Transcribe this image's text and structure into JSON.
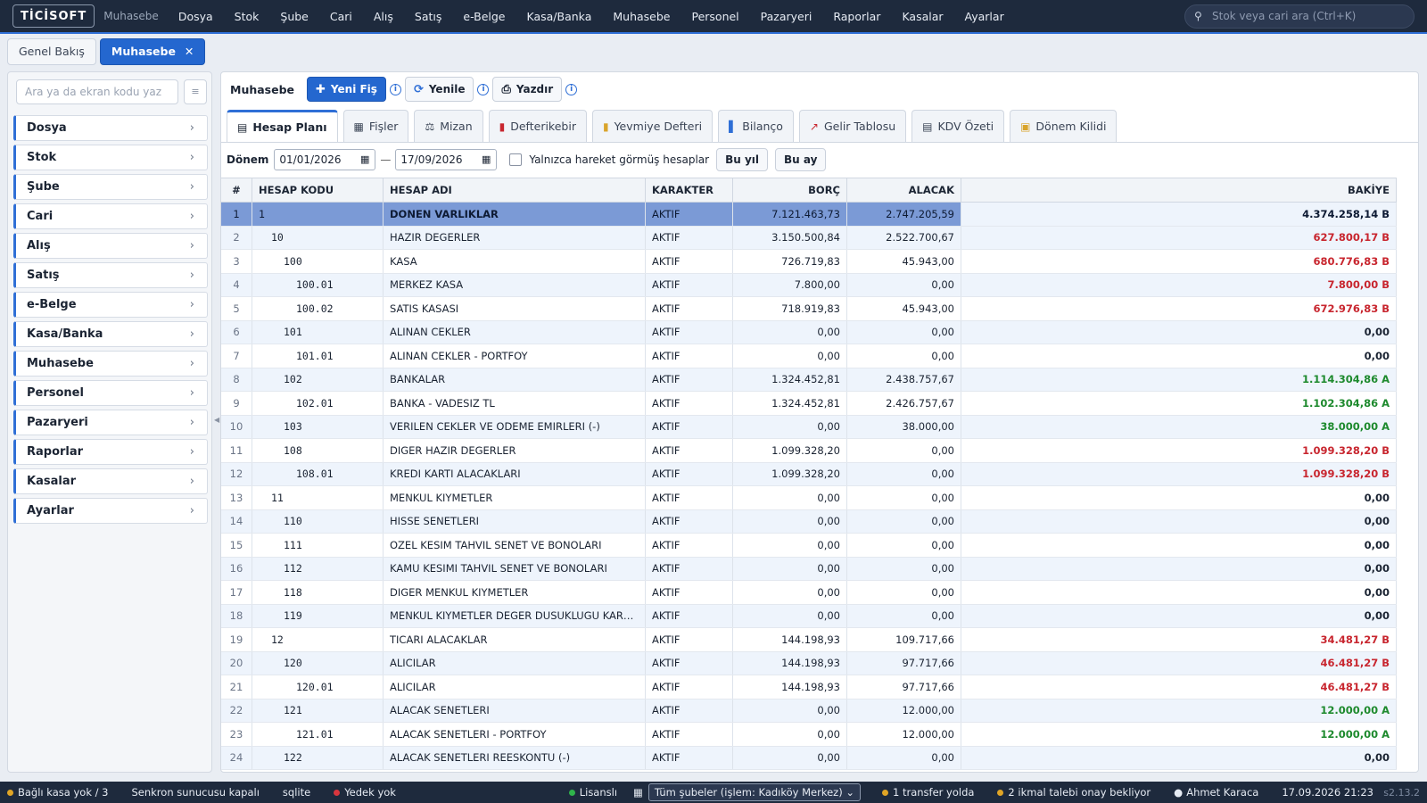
{
  "app": {
    "logo": "TİCİSOFT",
    "module": "Muhasebe"
  },
  "menu": [
    "Dosya",
    "Stok",
    "Şube",
    "Cari",
    "Alış",
    "Satış",
    "e-Belge",
    "Kasa/Banka",
    "Muhasebe",
    "Personel",
    "Pazaryeri",
    "Raporlar",
    "Kasalar",
    "Ayarlar"
  ],
  "search": {
    "placeholder": "Stok veya cari ara (Ctrl+K)"
  },
  "page_tabs": [
    {
      "label": "Genel Bakış"
    },
    {
      "label": "Muhasebe",
      "close": "✕"
    }
  ],
  "sidebar": {
    "search_placeholder": "Ara ya da ekran kodu yaz",
    "items": [
      "Dosya",
      "Stok",
      "Şube",
      "Cari",
      "Alış",
      "Satış",
      "e-Belge",
      "Kasa/Banka",
      "Muhasebe",
      "Personel",
      "Pazaryeri",
      "Raporlar",
      "Kasalar",
      "Ayarlar"
    ]
  },
  "toolbar": {
    "title": "Muhasebe",
    "new_label": "Yeni Fiş",
    "refresh_label": "Yenile",
    "print_label": "Yazdır",
    "info": "i"
  },
  "subtabs": [
    "Hesap Planı",
    "Fişler",
    "Mizan",
    "Defterikebir",
    "Yevmiye Defteri",
    "Bilanço",
    "Gelir Tablosu",
    "KDV Özeti",
    "Dönem Kilidi"
  ],
  "filter": {
    "label": "Dönem",
    "from": "01/01/2026",
    "to": "17/09/2026",
    "sep": "—",
    "only_moved": "Yalnızca hareket görmüş hesaplar",
    "this_year": "Bu yıl",
    "this_month": "Bu ay"
  },
  "table": {
    "headers": {
      "idx": "#",
      "code": "HESAP KODU",
      "name": "HESAP ADI",
      "type": "KARAKTER",
      "debit": "BORÇ",
      "credit": "ALACAK",
      "balance": "BAKİYE"
    },
    "rows": [
      {
        "i": "1",
        "code": "1",
        "lvl": 0,
        "name": "DONEN VARLIKLAR",
        "type": "AKTIF",
        "debit": "7.121.463,73",
        "credit": "2.747.205,59",
        "bal": "4.374.258,14 B",
        "s": "neg"
      },
      {
        "i": "2",
        "code": "10",
        "lvl": 1,
        "name": "HAZIR DEGERLER",
        "type": "AKTIF",
        "debit": "3.150.500,84",
        "credit": "2.522.700,67",
        "bal": "627.800,17 B",
        "s": "neg"
      },
      {
        "i": "3",
        "code": "100",
        "lvl": 2,
        "name": "KASA",
        "type": "AKTIF",
        "debit": "726.719,83",
        "credit": "45.943,00",
        "bal": "680.776,83 B",
        "s": "neg"
      },
      {
        "i": "4",
        "code": "100.01",
        "lvl": 3,
        "name": "MERKEZ KASA",
        "type": "AKTIF",
        "debit": "7.800,00",
        "credit": "0,00",
        "bal": "7.800,00 B",
        "s": "neg"
      },
      {
        "i": "5",
        "code": "100.02",
        "lvl": 3,
        "name": "SATIS KASASI",
        "type": "AKTIF",
        "debit": "718.919,83",
        "credit": "45.943,00",
        "bal": "672.976,83 B",
        "s": "neg"
      },
      {
        "i": "6",
        "code": "101",
        "lvl": 2,
        "name": "ALINAN CEKLER",
        "type": "AKTIF",
        "debit": "0,00",
        "credit": "0,00",
        "bal": "0,00",
        "s": "zero"
      },
      {
        "i": "7",
        "code": "101.01",
        "lvl": 3,
        "name": "ALINAN CEKLER - PORTFOY",
        "type": "AKTIF",
        "debit": "0,00",
        "credit": "0,00",
        "bal": "0,00",
        "s": "zero"
      },
      {
        "i": "8",
        "code": "102",
        "lvl": 2,
        "name": "BANKALAR",
        "type": "AKTIF",
        "debit": "1.324.452,81",
        "credit": "2.438.757,67",
        "bal": "1.114.304,86 A",
        "s": "pos"
      },
      {
        "i": "9",
        "code": "102.01",
        "lvl": 3,
        "name": "BANKA - VADESIZ TL",
        "type": "AKTIF",
        "debit": "1.324.452,81",
        "credit": "2.426.757,67",
        "bal": "1.102.304,86 A",
        "s": "pos"
      },
      {
        "i": "10",
        "code": "103",
        "lvl": 2,
        "name": "VERILEN CEKLER VE ODEME EMIRLERI (-)",
        "type": "AKTIF",
        "debit": "0,00",
        "credit": "38.000,00",
        "bal": "38.000,00 A",
        "s": "pos"
      },
      {
        "i": "11",
        "code": "108",
        "lvl": 2,
        "name": "DIGER HAZIR DEGERLER",
        "type": "AKTIF",
        "debit": "1.099.328,20",
        "credit": "0,00",
        "bal": "1.099.328,20 B",
        "s": "neg"
      },
      {
        "i": "12",
        "code": "108.01",
        "lvl": 3,
        "name": "KREDI KARTI ALACAKLARI",
        "type": "AKTIF",
        "debit": "1.099.328,20",
        "credit": "0,00",
        "bal": "1.099.328,20 B",
        "s": "neg"
      },
      {
        "i": "13",
        "code": "11",
        "lvl": 1,
        "name": "MENKUL KIYMETLER",
        "type": "AKTIF",
        "debit": "0,00",
        "credit": "0,00",
        "bal": "0,00",
        "s": "zero"
      },
      {
        "i": "14",
        "code": "110",
        "lvl": 2,
        "name": "HISSE SENETLERI",
        "type": "AKTIF",
        "debit": "0,00",
        "credit": "0,00",
        "bal": "0,00",
        "s": "zero"
      },
      {
        "i": "15",
        "code": "111",
        "lvl": 2,
        "name": "OZEL KESIM TAHVIL SENET VE BONOLARI",
        "type": "AKTIF",
        "debit": "0,00",
        "credit": "0,00",
        "bal": "0,00",
        "s": "zero"
      },
      {
        "i": "16",
        "code": "112",
        "lvl": 2,
        "name": "KAMU KESIMI TAHVIL SENET VE BONOLARI",
        "type": "AKTIF",
        "debit": "0,00",
        "credit": "0,00",
        "bal": "0,00",
        "s": "zero"
      },
      {
        "i": "17",
        "code": "118",
        "lvl": 2,
        "name": "DIGER MENKUL KIYMETLER",
        "type": "AKTIF",
        "debit": "0,00",
        "credit": "0,00",
        "bal": "0,00",
        "s": "zero"
      },
      {
        "i": "18",
        "code": "119",
        "lvl": 2,
        "name": "MENKUL KIYMETLER DEGER DUSUKLUGU KARSILIGI ...",
        "type": "AKTIF",
        "debit": "0,00",
        "credit": "0,00",
        "bal": "0,00",
        "s": "zero"
      },
      {
        "i": "19",
        "code": "12",
        "lvl": 1,
        "name": "TICARI ALACAKLAR",
        "type": "AKTIF",
        "debit": "144.198,93",
        "credit": "109.717,66",
        "bal": "34.481,27 B",
        "s": "neg"
      },
      {
        "i": "20",
        "code": "120",
        "lvl": 2,
        "name": "ALICILAR",
        "type": "AKTIF",
        "debit": "144.198,93",
        "credit": "97.717,66",
        "bal": "46.481,27 B",
        "s": "neg"
      },
      {
        "i": "21",
        "code": "120.01",
        "lvl": 3,
        "name": "ALICILAR",
        "type": "AKTIF",
        "debit": "144.198,93",
        "credit": "97.717,66",
        "bal": "46.481,27 B",
        "s": "neg"
      },
      {
        "i": "22",
        "code": "121",
        "lvl": 2,
        "name": "ALACAK SENETLERI",
        "type": "AKTIF",
        "debit": "0,00",
        "credit": "12.000,00",
        "bal": "12.000,00 A",
        "s": "pos"
      },
      {
        "i": "23",
        "code": "121.01",
        "lvl": 3,
        "name": "ALACAK SENETLERI - PORTFOY",
        "type": "AKTIF",
        "debit": "0,00",
        "credit": "12.000,00",
        "bal": "12.000,00 A",
        "s": "pos"
      },
      {
        "i": "24",
        "code": "122",
        "lvl": 2,
        "name": "ALACAK SENETLERI REESKONTU (-)",
        "type": "AKTIF",
        "debit": "0,00",
        "credit": "0,00",
        "bal": "0,00",
        "s": "zero"
      }
    ]
  },
  "statusbar": {
    "kasa": "Bağlı kasa yok / 3",
    "sync": "Senkron sunucusu kapalı",
    "db": "sqlite",
    "backup": "Yedek yok",
    "license": "Lisanslı",
    "branch": "Tüm şubeler (işlem: Kadıköy Merkez)",
    "transfer": "1 transfer yolda",
    "pending": "2 ikmal talebi onay bekliyor",
    "user": "Ahmet Karaca",
    "datetime": "17.09.2026 21:23",
    "version": "s2.13.2"
  },
  "colors": {
    "accent": "#2467cf",
    "topbar": "#1e2a3d",
    "negative": "#c8262f",
    "positive": "#1e8a2e",
    "selected_row": "#7b9ad6"
  }
}
